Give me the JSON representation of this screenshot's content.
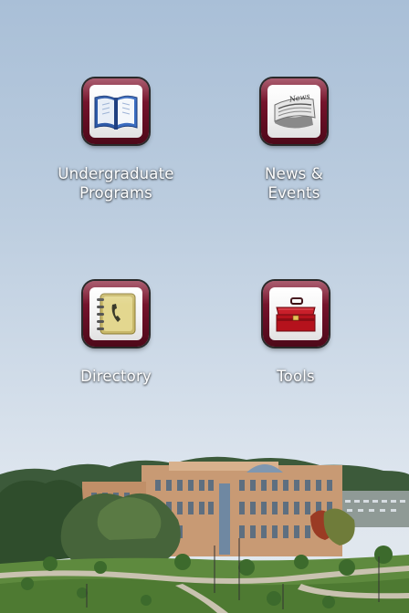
{
  "tiles": [
    {
      "id": "undergraduate-programs",
      "label_line1": "Undergraduate",
      "label_line2": "Programs",
      "icon": "open-book-icon"
    },
    {
      "id": "news-events",
      "label_line1": "News &",
      "label_line2": "Events",
      "icon": "newspaper-icon"
    },
    {
      "id": "directory",
      "label_line1": "Directory",
      "label_line2": "",
      "icon": "phone-book-icon"
    },
    {
      "id": "tools",
      "label_line1": "Tools",
      "label_line2": "",
      "icon": "toolbox-icon"
    }
  ],
  "newspaper_masthead": "News",
  "colors": {
    "icon_frame": "#6a0f26",
    "label_text": "#ffffff",
    "sky_top": "#a9bfd7",
    "sky_bottom": "#e3e9ef",
    "building_brick": "#c89a74"
  },
  "background": "campus-photo"
}
